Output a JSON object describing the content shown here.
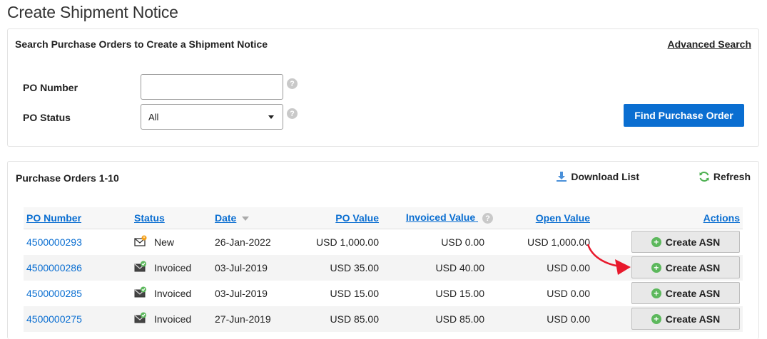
{
  "page": {
    "title": "Create Shipment Notice"
  },
  "search": {
    "heading": "Search Purchase Orders to Create a Shipment Notice",
    "advanced_link": "Advanced Search",
    "po_number_label": "PO Number",
    "po_number_value": "",
    "po_status_label": "PO Status",
    "po_status_selected": "All",
    "help_glyph": "?",
    "find_button": "Find Purchase Order"
  },
  "results": {
    "heading": "Purchase Orders 1-10",
    "download_label": "Download List",
    "refresh_label": "Refresh",
    "columns": {
      "po_number": "PO Number",
      "status": "Status",
      "date": "Date",
      "po_value": "PO Value",
      "invoiced_value": "Invoiced Value",
      "open_value": "Open Value",
      "actions": "Actions"
    },
    "action_plus": "+",
    "rows": [
      {
        "po_number": "4500000293",
        "status": "New",
        "status_icon": "envelope-new-icon",
        "date": "26-Jan-2022",
        "po_value": "USD 1,000.00",
        "invoiced_value": "USD 0.00",
        "open_value": "USD 1,000.00",
        "action": "Create ASN"
      },
      {
        "po_number": "4500000286",
        "status": "Invoiced",
        "status_icon": "envelope-check-icon",
        "date": "03-Jul-2019",
        "po_value": "USD 35.00",
        "invoiced_value": "USD 40.00",
        "open_value": "USD 0.00",
        "action": "Create ASN"
      },
      {
        "po_number": "4500000285",
        "status": "Invoiced",
        "status_icon": "envelope-check-icon",
        "date": "03-Jul-2019",
        "po_value": "USD 15.00",
        "invoiced_value": "USD 15.00",
        "open_value": "USD 0.00",
        "action": "Create ASN"
      },
      {
        "po_number": "4500000275",
        "status": "Invoiced",
        "status_icon": "envelope-check-icon",
        "date": "27-Jun-2019",
        "po_value": "USD 85.00",
        "invoiced_value": "USD 85.00",
        "open_value": "USD 0.00",
        "action": "Create ASN"
      }
    ]
  },
  "colors": {
    "link_blue": "#0a6ed1",
    "primary_button": "#0a6ed1",
    "plus_green": "#5cb85c",
    "refresh_green": "#4caf50",
    "annotation_red": "#e8192c"
  }
}
